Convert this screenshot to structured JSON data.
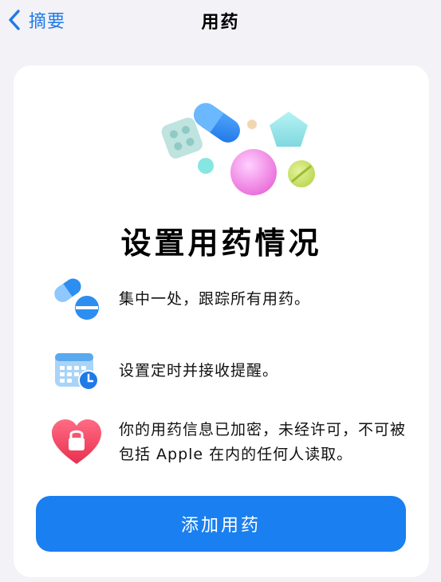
{
  "navbar": {
    "back_label": "摘要",
    "title": "用药"
  },
  "card": {
    "headline": "设置用药情况",
    "features": [
      {
        "icon": "pills-icon",
        "text": "集中一处，跟踪所有用药。"
      },
      {
        "icon": "calendar-clock-icon",
        "text": "设置定时并接收提醒。"
      },
      {
        "icon": "heart-lock-icon",
        "text": "你的用药信息已加密，未经许可，不可被包括 Apple 在内的任何人读取。"
      }
    ],
    "button_label": "添加用药"
  },
  "colors": {
    "accent": "#1a7ff0",
    "link": "#1f7ae8",
    "background": "#f2f2f7",
    "heart": "#ee3f5e"
  }
}
